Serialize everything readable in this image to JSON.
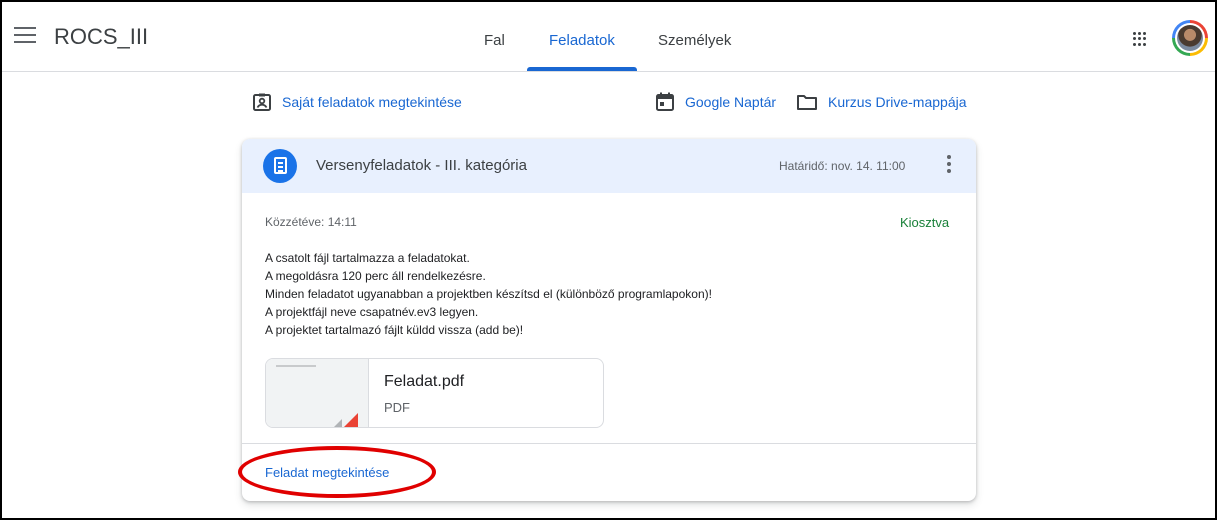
{
  "app": {
    "title": "ROCS_III"
  },
  "tabs": [
    {
      "label": "Fal"
    },
    {
      "label": "Feladatok",
      "active": true
    },
    {
      "label": "Személyek"
    }
  ],
  "links": {
    "own_tasks": "Saját feladatok megtekintése",
    "calendar": "Google Naptár",
    "drive": "Kurzus Drive-mappája"
  },
  "assignment": {
    "title": "Versenyfeladatok - III. kategória",
    "due": "Határidő: nov. 14. 11:00",
    "posted": "Közzétéve: 14:11",
    "status": "Kiosztva",
    "description": [
      "A csatolt fájl tartalmazza a feladatokat.",
      "A megoldásra 120 perc áll rendelkezésre.",
      "Minden feladatot ugyanabban a projektben készítsd el (különböző programlapokon)!",
      "A projektfájl neve csapatnév.ev3 legyen.",
      "A projektet tartalmazó fájlt küldd vissza (add be)!"
    ],
    "attachment": {
      "name": "Feladat.pdf",
      "type": "PDF"
    },
    "view_link": "Feladat megtekintése"
  },
  "colors": {
    "accent": "#1967d2",
    "status": "#188038",
    "highlight": "#e00000",
    "header_bg": "#e8f0fe"
  }
}
